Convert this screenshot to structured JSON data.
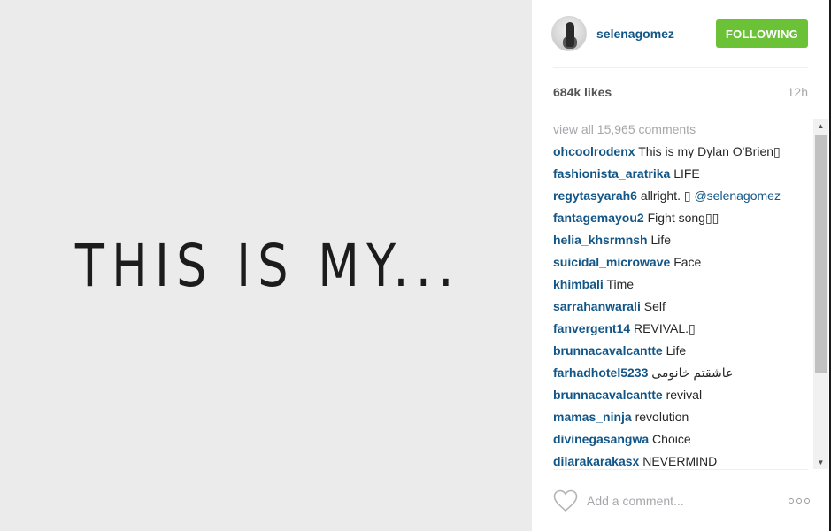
{
  "post_image": {
    "caption_text": "THIS IS MY..."
  },
  "header": {
    "username": "selenagomez",
    "follow_label": "FOLLOWING",
    "follow_color": "#6bc237"
  },
  "stats": {
    "likes": "684k likes",
    "time": "12h"
  },
  "comments": {
    "view_all": "view all 15,965 comments",
    "items": [
      {
        "user": "ohcoolrodenx",
        "text": "This is my Dylan O'Brien▯"
      },
      {
        "user": "fashionista_aratrika",
        "text": "LIFE"
      },
      {
        "user": "regytasyarah6",
        "text": "allright. ▯",
        "mention": "@selenagomez"
      },
      {
        "user": "fantagemayou2",
        "text": "Fight song▯▯"
      },
      {
        "user": "helia_khsrmnsh",
        "text": "Life"
      },
      {
        "user": "suicidal_microwave",
        "text": "Face"
      },
      {
        "user": "khimbali",
        "text": "Time"
      },
      {
        "user": "sarrahanwarali",
        "text": "Self"
      },
      {
        "user": "fanvergent14",
        "text": "REVIVAL.▯"
      },
      {
        "user": "brunnacavalcantte",
        "text": "Life"
      },
      {
        "user": "farhadhotel5233",
        "text": "عاشقتم خانومی"
      },
      {
        "user": "brunnacavalcantte",
        "text": "revival"
      },
      {
        "user": "mamas_ninja",
        "text": "revolution"
      },
      {
        "user": "divinegasangwa",
        "text": "Choice"
      },
      {
        "user": "dilarakarakasx",
        "text": "NEVERMIND"
      }
    ]
  },
  "footer": {
    "comment_placeholder": "Add a comment...",
    "like_icon": "heart-outline-icon",
    "more_icon": "more-options-icon"
  },
  "colors": {
    "link": "#125688",
    "muted": "#a5a7aa",
    "image_bg": "#ebebeb"
  }
}
